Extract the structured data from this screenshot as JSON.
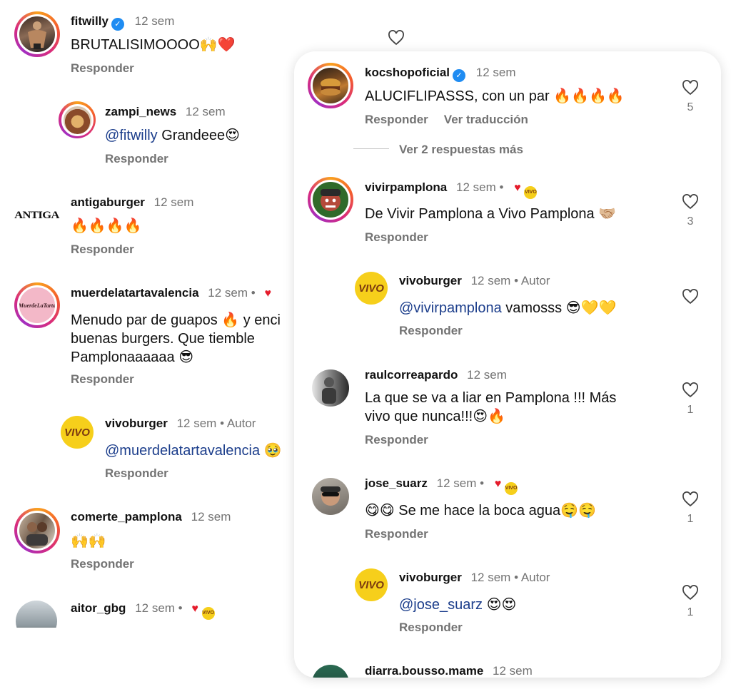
{
  "left": {
    "comments": [
      {
        "user": "fitwilly",
        "time": "12 sem",
        "text": "BRUTALISIMOOOO🙌❤️",
        "reply": "Responder"
      },
      {
        "user": "zampi_news",
        "time": "12 sem",
        "mention": "@fitwilly",
        "text": " Grandeee😍",
        "reply": "Responder"
      },
      {
        "user": "antigaburger",
        "time": "12 sem",
        "text": "🔥🔥🔥🔥",
        "reply": "Responder",
        "avatar_label": "ANTIGA"
      },
      {
        "user": "muerdelatartavalencia",
        "time": "12 sem",
        "dot": "•",
        "text_lines": [
          "Menudo par de guapos 🔥 y enci",
          "buenas burgers. Que tiemble",
          "Pamplonaaaaaa 😎"
        ],
        "reply": "Responder",
        "avatar_label": "MuerdeLaTarta"
      },
      {
        "user": "vivoburger",
        "time": "12 sem",
        "dot": "•",
        "author": "Autor",
        "mention": "@muerdelatartavalencia",
        "text": " 🥹",
        "reply": "Responder",
        "avatar_label": "VIVO"
      },
      {
        "user": "comerte_pamplona",
        "time": "12 sem",
        "text": "🙌🙌",
        "reply": "Responder"
      },
      {
        "user": "aitor_gbg",
        "time": "12 sem",
        "dot": "•"
      }
    ]
  },
  "right": {
    "comments": [
      {
        "user": "kocshopoficial",
        "time": "12 sem",
        "text": "ALUCIFLIPASSS, con un par 🔥🔥🔥🔥",
        "reply": "Responder",
        "translate": "Ver traducción",
        "likes": "5"
      },
      {
        "more": "Ver 2 respuestas más"
      },
      {
        "user": "vivirpamplona",
        "time": "12 sem",
        "dot": "•",
        "text": "De Vivir Pamplona a Vivo Pamplona 🤝🏼",
        "reply": "Responder",
        "likes": "3"
      },
      {
        "user": "vivoburger",
        "time": "12 sem",
        "dot": "•",
        "author": "Autor",
        "mention": "@vivirpamplona",
        "text": " vamosss 😎💛💛",
        "reply": "Responder",
        "avatar_label": "VIVO"
      },
      {
        "user": "raulcorreapardo",
        "time": "12 sem",
        "text_lines": [
          "La que se va a liar en Pamplona !!! Más",
          "vivo que nunca!!!😍🔥"
        ],
        "reply": "Responder",
        "likes": "1"
      },
      {
        "user": "jose_suarz",
        "time": "12 sem",
        "dot": "•",
        "text": "😋😋 Se me hace la boca agua🤤🤤",
        "reply": "Responder",
        "likes": "1"
      },
      {
        "user": "vivoburger",
        "time": "12 sem",
        "dot": "•",
        "author": "Autor",
        "mention": "@jose_suarz",
        "text": " 😍😍",
        "reply": "Responder",
        "likes": "1",
        "avatar_label": "VIVO"
      },
      {
        "user": "diarra.bousso.mame",
        "time": "12 sem"
      }
    ]
  },
  "mini_logo": "VIVO",
  "verified_glyph": "✓",
  "heart_glyph": "♥",
  "colors": {
    "verified": "#1f8cf2",
    "mention": "#1b3d8b",
    "meta": "#737373",
    "vivo_yellow": "#f6cf1b",
    "ring": "#d82b7e"
  }
}
